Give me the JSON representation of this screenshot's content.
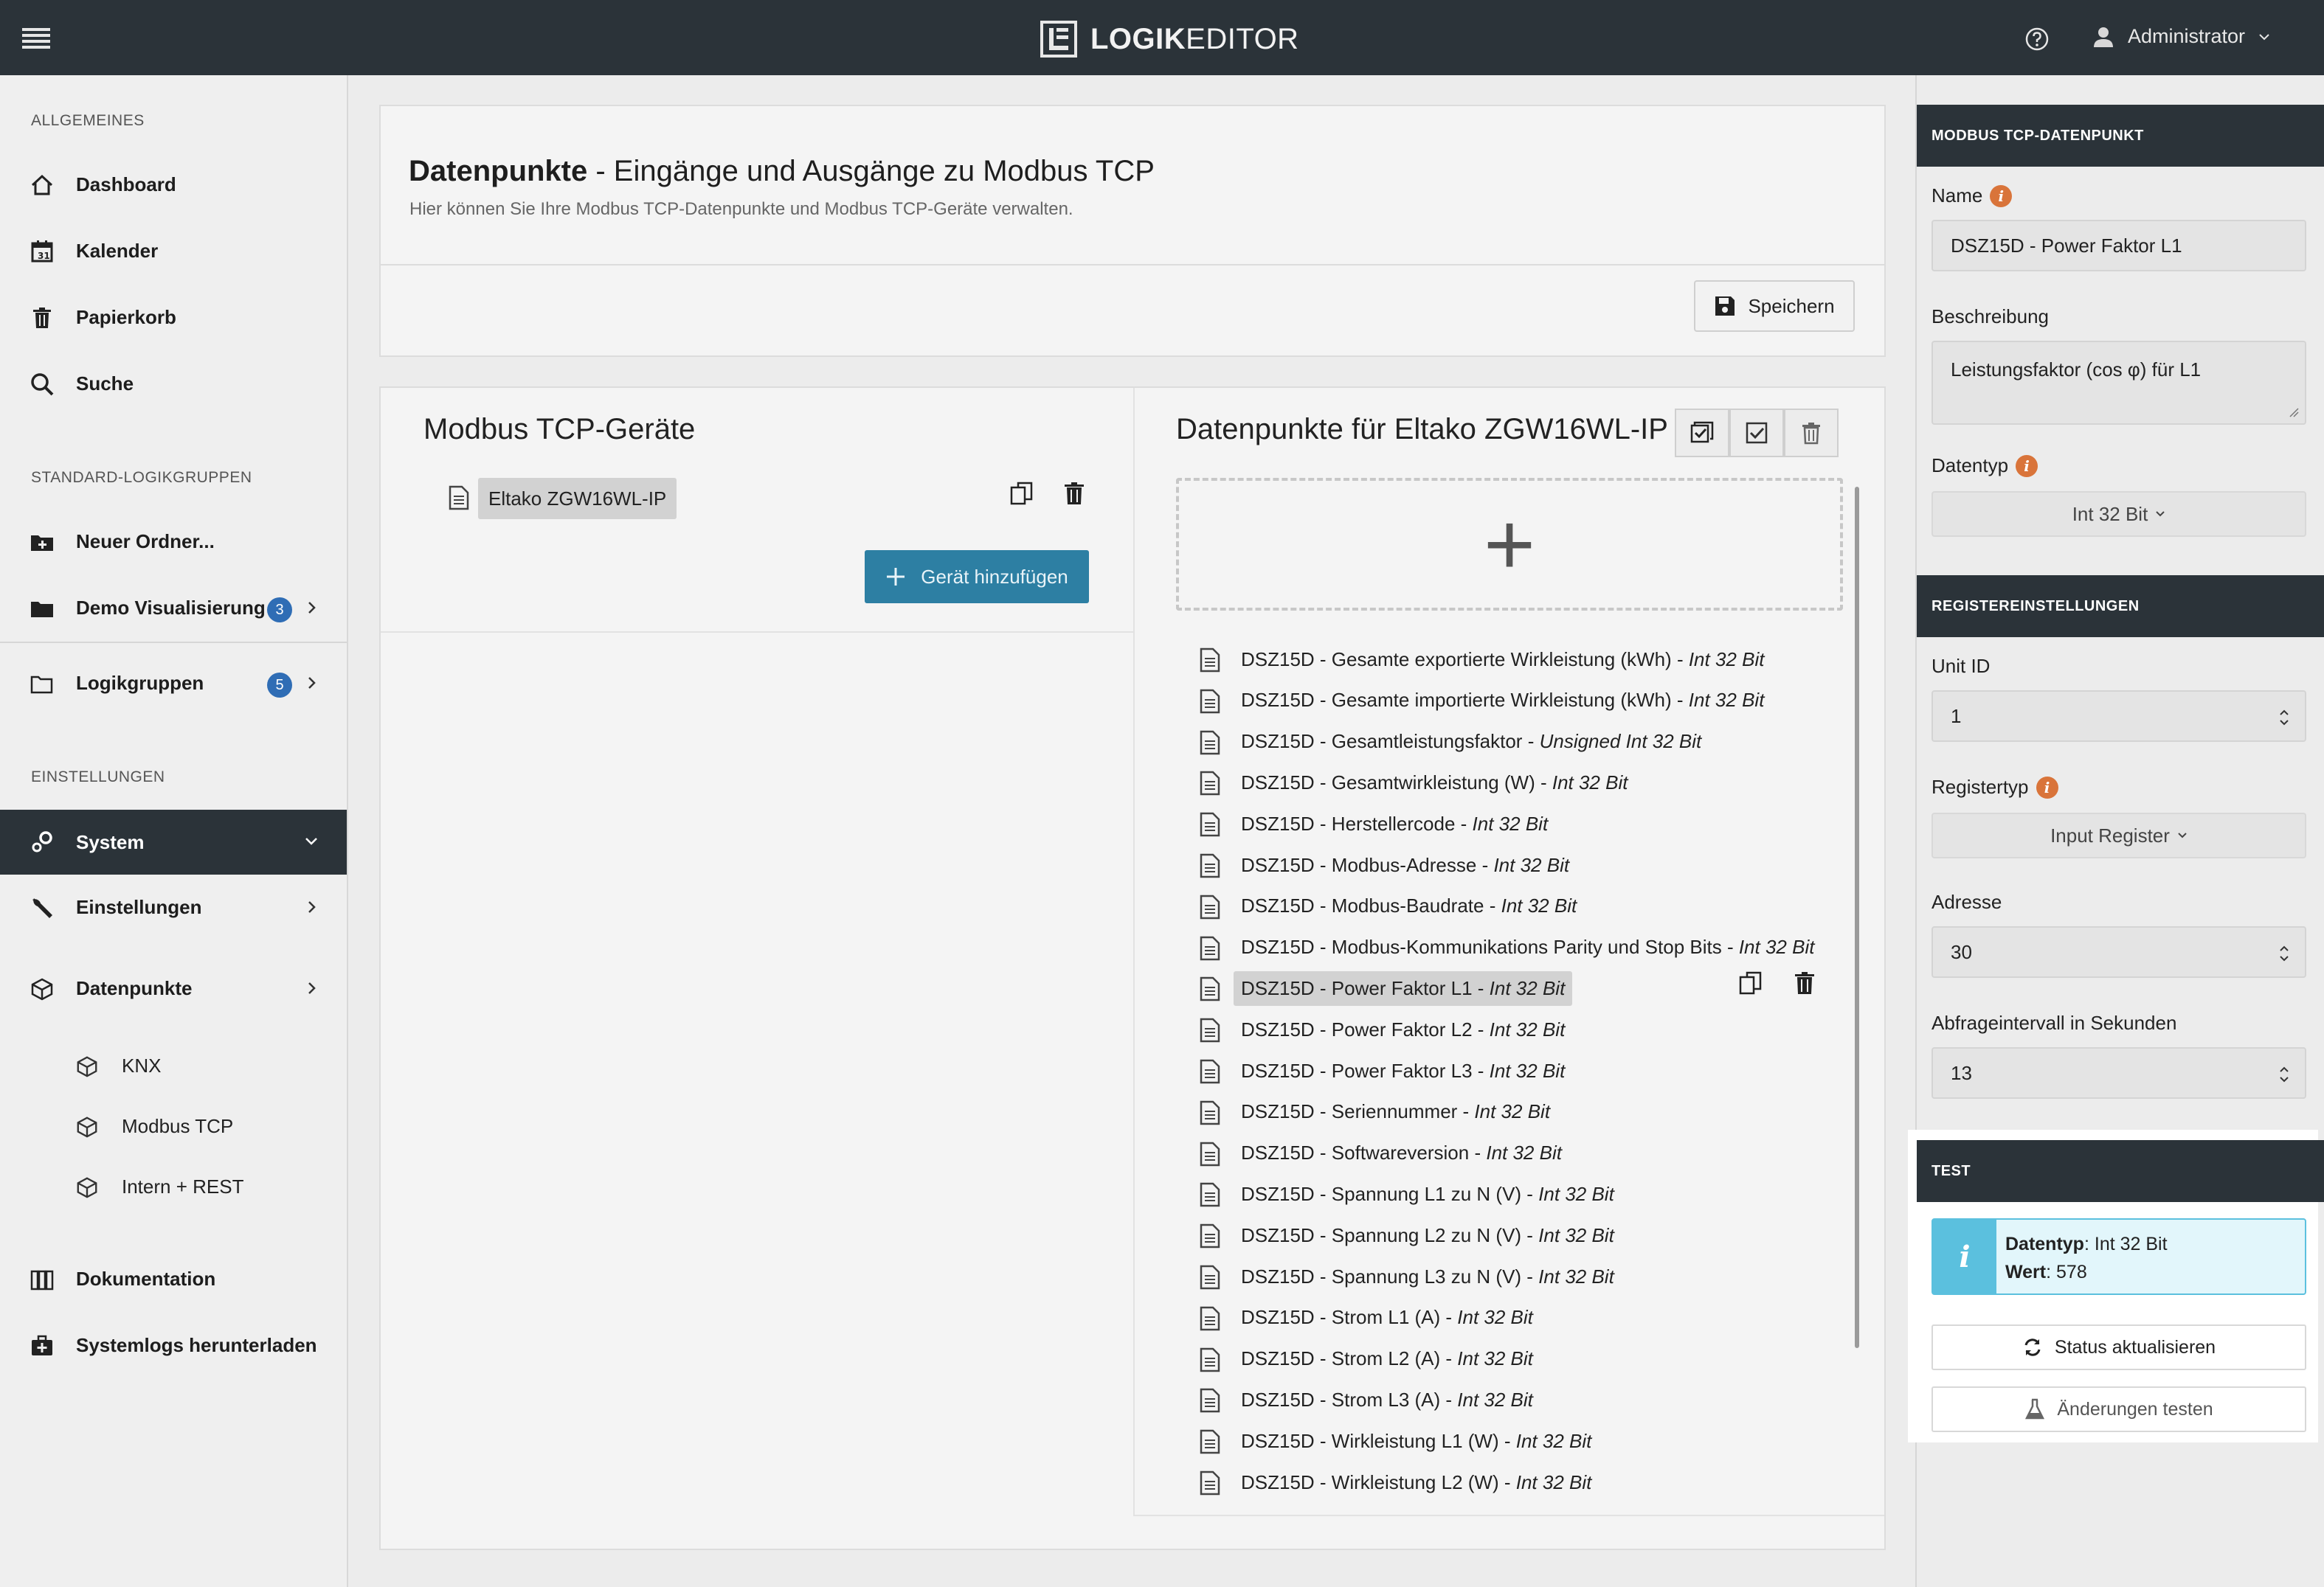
{
  "topbar": {
    "brand_bold": "LOGIK",
    "brand_rest": "EDITOR",
    "user": "Administrator"
  },
  "sidebar": {
    "section_general": "ALLGEMEINES",
    "items_general": [
      {
        "label": "Dashboard",
        "icon": "home-icon"
      },
      {
        "label": "Kalender",
        "icon": "calendar-icon"
      },
      {
        "label": "Papierkorb",
        "icon": "trash-icon"
      },
      {
        "label": "Suche",
        "icon": "search-icon"
      }
    ],
    "section_groups": "STANDARD-LOGIKGRUPPEN",
    "items_groups": [
      {
        "label": "Neuer Ordner...",
        "icon": "folder-plus-icon"
      },
      {
        "label": "Demo Visualisierung",
        "badge": "3",
        "icon": "folder-icon"
      },
      {
        "label": "Logikgruppen",
        "badge": "5",
        "icon": "folder-open-icon"
      }
    ],
    "section_settings": "EINSTELLUNGEN",
    "items_settings": [
      {
        "label": "System",
        "icon": "gears-icon"
      },
      {
        "label": "Einstellungen",
        "icon": "wrench-icon"
      },
      {
        "label": "Datenpunkte",
        "icon": "cube-icon"
      }
    ],
    "sub_items": [
      {
        "label": "KNX"
      },
      {
        "label": "Modbus TCP"
      },
      {
        "label": "Intern + REST"
      }
    ],
    "items_footer": [
      {
        "label": "Dokumentation",
        "icon": "books-icon"
      },
      {
        "label": "Systemlogs herunterladen",
        "icon": "medkit-icon"
      }
    ]
  },
  "header": {
    "title_bold": "Datenpunkte",
    "title_rest": " - Eingänge und Ausgänge zu Modbus TCP",
    "subtitle": "Hier können Sie Ihre Modbus TCP-Datenpunkte und Modbus TCP-Geräte verwalten.",
    "save_label": "Speichern"
  },
  "devices": {
    "title": "Modbus TCP-Geräte",
    "items": [
      "Eltako ZGW16WL-IP"
    ],
    "add_label": "Gerät hinzufügen"
  },
  "datapoints": {
    "title": "Datenpunkte für Eltako ZGW16WL-IP",
    "dropzone_symbol": "+",
    "selected_index": 8,
    "items": [
      {
        "name": "DSZ15D - Gesamte exportierte Wirkleistung (kWh)",
        "type": "Int 32 Bit"
      },
      {
        "name": "DSZ15D - Gesamte importierte Wirkleistung (kWh)",
        "type": "Int 32 Bit"
      },
      {
        "name": "DSZ15D - Gesamtleistungsfaktor",
        "type": "Unsigned Int 32 Bit"
      },
      {
        "name": "DSZ15D - Gesamtwirkleistung (W)",
        "type": "Int 32 Bit"
      },
      {
        "name": "DSZ15D - Herstellercode",
        "type": "Int 32 Bit"
      },
      {
        "name": "DSZ15D - Modbus-Adresse",
        "type": "Int 32 Bit"
      },
      {
        "name": "DSZ15D - Modbus-Baudrate",
        "type": "Int 32 Bit"
      },
      {
        "name": "DSZ15D - Modbus-Kommunikations Parity und Stop Bits",
        "type": "Int 32 Bit"
      },
      {
        "name": "DSZ15D - Power Faktor L1",
        "type": "Int 32 Bit"
      },
      {
        "name": "DSZ15D - Power Faktor L2",
        "type": "Int 32 Bit"
      },
      {
        "name": "DSZ15D - Power Faktor L3",
        "type": "Int 32 Bit"
      },
      {
        "name": "DSZ15D - Seriennummer",
        "type": "Int 32 Bit"
      },
      {
        "name": "DSZ15D - Softwareversion",
        "type": "Int 32 Bit"
      },
      {
        "name": "DSZ15D - Spannung L1 zu N (V)",
        "type": "Int 32 Bit"
      },
      {
        "name": "DSZ15D - Spannung L2 zu N (V)",
        "type": "Int 32 Bit"
      },
      {
        "name": "DSZ15D - Spannung L3 zu N (V)",
        "type": "Int 32 Bit"
      },
      {
        "name": "DSZ15D - Strom L1 (A)",
        "type": "Int 32 Bit"
      },
      {
        "name": "DSZ15D - Strom L2 (A)",
        "type": "Int 32 Bit"
      },
      {
        "name": "DSZ15D - Strom L3 (A)",
        "type": "Int 32 Bit"
      },
      {
        "name": "DSZ15D - Wirkleistung L1 (W)",
        "type": "Int 32 Bit"
      },
      {
        "name": "DSZ15D - Wirkleistung L2 (W)",
        "type": "Int 32 Bit"
      }
    ]
  },
  "detail": {
    "section_datapoint": "MODBUS TCP-DATENPUNKT",
    "name_label": "Name",
    "name_value": "DSZ15D - Power Faktor L1",
    "desc_label": "Beschreibung",
    "desc_value": "Leistungsfaktor (cos φ) für L1",
    "type_label": "Datentyp",
    "type_value": "Int 32 Bit",
    "section_register": "REGISTEREINSTELLUNGEN",
    "unit_label": "Unit ID",
    "unit_value": "1",
    "regtype_label": "Registertyp",
    "regtype_value": "Input Register",
    "address_label": "Adresse",
    "address_value": "30",
    "interval_label": "Abfrageintervall in Sekunden",
    "interval_value": "13",
    "section_test": "TEST",
    "alert_type_label": "Datentyp",
    "alert_type_value": "Int 32 Bit",
    "alert_value_label": "Wert",
    "alert_value_value": "578",
    "refresh_label": "Status aktualisieren",
    "test_label": "Änderungen testen"
  },
  "colors": {
    "topbar": "#2b3339",
    "accent_button": "#2d7fa3",
    "badge": "#2f6db5",
    "info_orange": "#d9743a",
    "alert_info": "#5bc0de"
  }
}
